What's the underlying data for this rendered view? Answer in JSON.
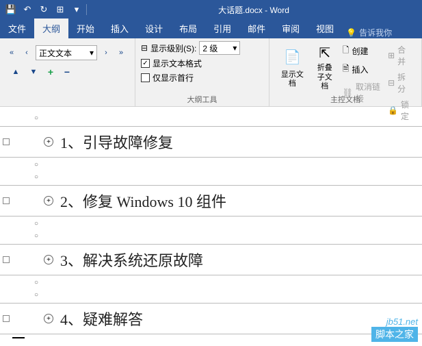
{
  "titlebar": {
    "save_icon": "💾",
    "undo": "↶",
    "redo": "↻",
    "touch": "⊞",
    "dropdown": "▾",
    "title": "大话题.docx - Word"
  },
  "tabs": {
    "file": "文件",
    "outline": "大纲",
    "home": "开始",
    "insert": "插入",
    "design": "设计",
    "layout": "布局",
    "references": "引用",
    "mail": "邮件",
    "review": "审阅",
    "view": "视图",
    "tellme_icon": "💡",
    "tellme": "告诉我你"
  },
  "outline_group": {
    "body_text": "正文文本",
    "arrow": "▾",
    "plus": "+",
    "minus": "−",
    "left2": "«",
    "left1": "‹",
    "right1": "›",
    "right2": "»",
    "up": "▲",
    "down": "▼"
  },
  "tools_group": {
    "show_level_icon": "⊟",
    "show_level_label": "显示级别(S):",
    "level_value": "2 级",
    "show_format": "显示文本格式",
    "first_line_only": "仅显示首行",
    "check": "✓",
    "label": "大纲工具"
  },
  "master_group": {
    "show_doc": "显示文档",
    "collapse": "折叠\n子文档",
    "create": "创建",
    "insert": "插入",
    "unlink": "取消链接",
    "merge": "合并",
    "split": "拆分",
    "lock": "锁定",
    "label": "主控文档",
    "icon_doc": "📄",
    "icon_collapse": "⇱",
    "icon_create": "🗋",
    "icon_insert": "🗎",
    "icon_unlink": "⛓",
    "icon_merge": "⊞",
    "icon_split": "⊟",
    "icon_lock": "🔒"
  },
  "content": {
    "bullet": "○",
    "expand": "+",
    "h1": "1、引导故障修复",
    "h2": "2、修复 Windows 10 组件",
    "h3": "3、解决系统还原故障",
    "h4": "4、疑难解答"
  },
  "watermark": {
    "url": "jb51.net",
    "text": "脚本之家"
  }
}
